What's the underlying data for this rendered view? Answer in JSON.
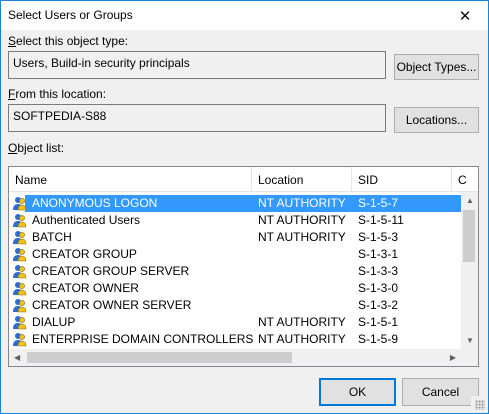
{
  "window": {
    "title": "Select Users or Groups",
    "close_glyph": "✕"
  },
  "object_type": {
    "label_prefix": "S",
    "label_rest": "elect this object type:",
    "value": "Users, Build-in security principals",
    "button": "Object Types..."
  },
  "location": {
    "label_prefix": "F",
    "label_rest": "rom this location:",
    "value": "SOFTPEDIA-S88",
    "button": "Locations..."
  },
  "object_list": {
    "label_prefix": "O",
    "label_rest": "bject list:",
    "columns": [
      "Name",
      "Location",
      "SID",
      "C"
    ],
    "rows": [
      {
        "name": "ANONYMOUS LOGON",
        "location": "NT AUTHORITY",
        "sid": "S-1-5-7",
        "selected": true
      },
      {
        "name": "Authenticated Users",
        "location": "NT AUTHORITY",
        "sid": "S-1-5-11"
      },
      {
        "name": "BATCH",
        "location": "NT AUTHORITY",
        "sid": "S-1-5-3"
      },
      {
        "name": "CREATOR GROUP",
        "location": "",
        "sid": "S-1-3-1"
      },
      {
        "name": "CREATOR GROUP SERVER",
        "location": "",
        "sid": "S-1-3-3"
      },
      {
        "name": "CREATOR OWNER",
        "location": "",
        "sid": "S-1-3-0"
      },
      {
        "name": "CREATOR OWNER SERVER",
        "location": "",
        "sid": "S-1-3-2"
      },
      {
        "name": "DIALUP",
        "location": "NT AUTHORITY",
        "sid": "S-1-5-1"
      },
      {
        "name": "ENTERPRISE DOMAIN CONTROLLERS",
        "location": "NT AUTHORITY",
        "sid": "S-1-5-9"
      }
    ]
  },
  "buttons": {
    "ok": "OK",
    "cancel": "Cancel"
  },
  "colors": {
    "selection": "#3399ff",
    "accent": "#0078d7"
  }
}
